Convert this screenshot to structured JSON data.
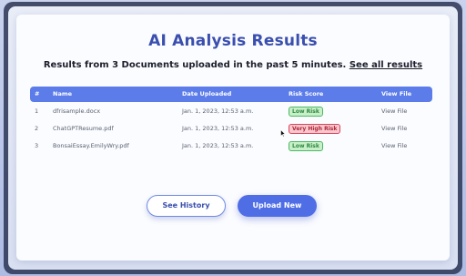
{
  "page": {
    "title": "AI Analysis Results",
    "subtitle_text": "Results from 3 Documents uploaded in the past 5 minutes.",
    "see_all_link": "See all results"
  },
  "table": {
    "headers": [
      "#",
      "Name",
      "Date Uploaded",
      "Risk Score",
      "View File"
    ],
    "rows": [
      {
        "num": "1",
        "name": "dfrisample.docx",
        "date": "Jan. 1, 2023, 12:53 a.m.",
        "risk": "Low Risk",
        "risk_level": "low",
        "view": "View File"
      },
      {
        "num": "2",
        "name": "ChatGPTResume.pdf",
        "date": "Jan. 1, 2023, 12:53 a.m.",
        "risk": "Very High Risk",
        "risk_level": "high",
        "view": "View File"
      },
      {
        "num": "3",
        "name": "BonsaiEssay.EmilyWry.pdf",
        "date": "Jan. 1, 2023, 12:53 a.m.",
        "risk": "Low Risk",
        "risk_level": "low",
        "view": "View File"
      }
    ]
  },
  "buttons": {
    "history": "See History",
    "upload": "Upload New"
  },
  "colors": {
    "accent": "#5b7ce9",
    "title": "#3a4fae",
    "low_risk": "#4cb864",
    "high_risk": "#d9455a"
  },
  "icons": {
    "cursor": "mouse-pointer-icon"
  }
}
